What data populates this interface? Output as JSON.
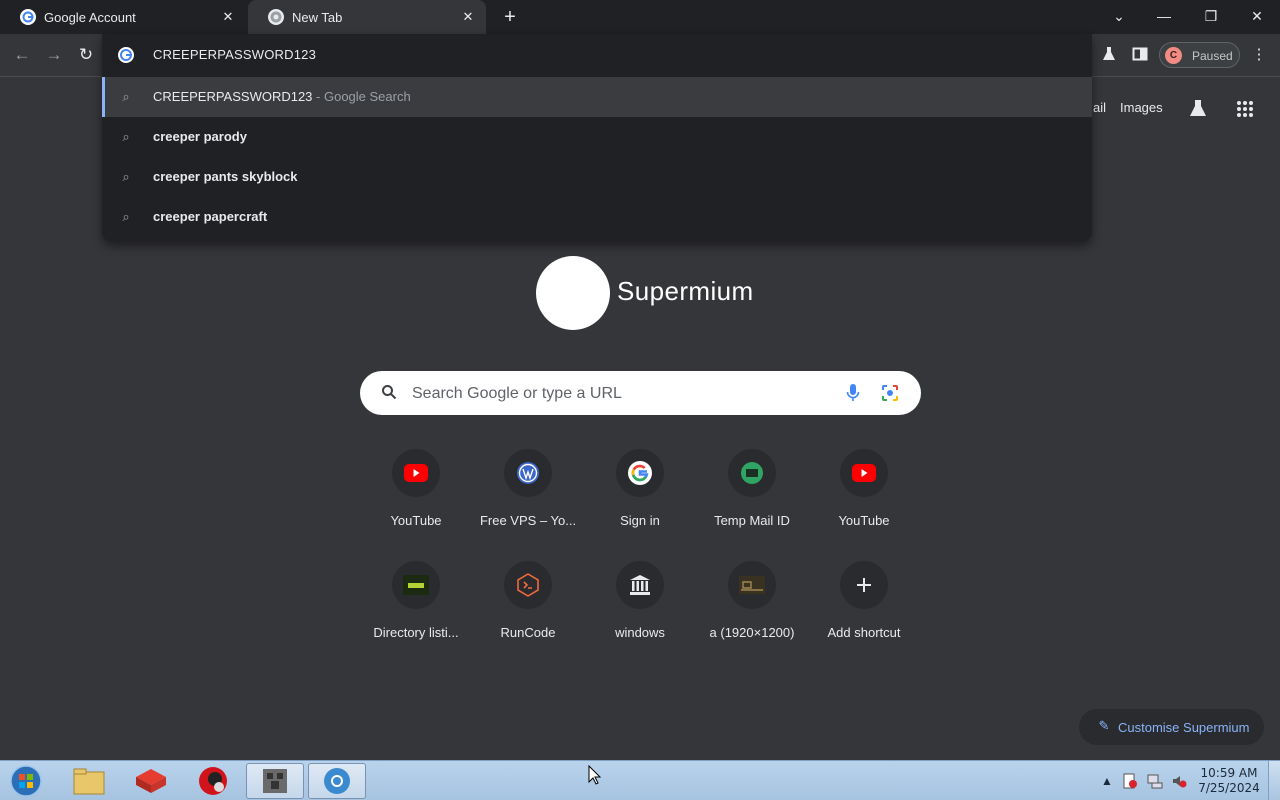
{
  "tabs": [
    {
      "title": "Google Account",
      "icon": "google-g-icon"
    },
    {
      "title": "New Tab",
      "icon": "chrome-icon"
    }
  ],
  "omnibox": {
    "value": "CREEPERPASSWORD123",
    "suggestions": [
      {
        "text": "CREEPERPASSWORD123",
        "sub": " - Google Search"
      },
      {
        "text": "creeper parody",
        "sub": ""
      },
      {
        "text": "creeper pants skyblock",
        "sub": ""
      },
      {
        "text": "creeper papercraft",
        "sub": ""
      }
    ]
  },
  "profile": {
    "initial": "C",
    "status": "Paused"
  },
  "ntp": {
    "links": {
      "gmail": "ail",
      "images": "Images"
    },
    "logo_text": "Supermium",
    "search_placeholder": "Search Google or type a URL",
    "shortcuts": [
      {
        "title": "YouTube",
        "icon": "youtube-icon"
      },
      {
        "title": "Free VPS – Yo...",
        "icon": "wordpress-icon"
      },
      {
        "title": "Sign in",
        "icon": "google-g-icon"
      },
      {
        "title": "Temp Mail ID",
        "icon": "tempmail-icon"
      },
      {
        "title": "YouTube",
        "icon": "youtube-icon"
      },
      {
        "title": "Directory listi...",
        "icon": "vnc-icon"
      },
      {
        "title": "RunCode",
        "icon": "runcode-icon"
      },
      {
        "title": "windows",
        "icon": "bank-icon"
      },
      {
        "title": "a (1920×1200)",
        "icon": "image-thumb-icon"
      },
      {
        "title": "Add shortcut",
        "icon": "plus-icon"
      }
    ],
    "customise_label": "Customise Supermium"
  },
  "taskbar": {
    "time": "10:59 AM",
    "date": "7/25/2024"
  },
  "colors": {
    "tabstrip": "#202124",
    "toolbar": "#35363a",
    "accent": "#8ab4f8",
    "taskbar": "#b9d3ec"
  }
}
